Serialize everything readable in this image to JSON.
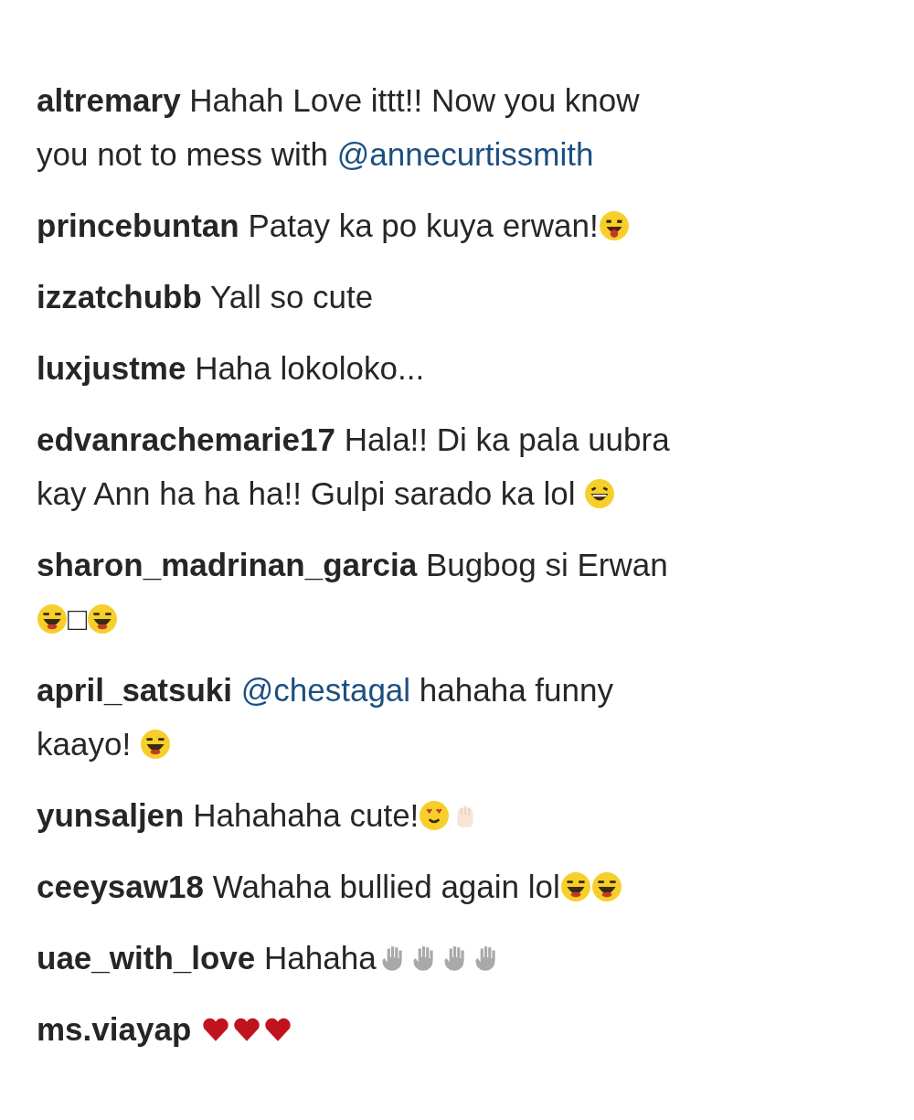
{
  "comments": [
    {
      "username": "altremary",
      "lines": [
        [
          {
            "kind": "text",
            "text": "Hahah Love ittt!! Now you know"
          }
        ],
        [
          {
            "kind": "text",
            "text": "you not to mess with "
          },
          {
            "kind": "mention",
            "text": "@annecurtissmith"
          }
        ]
      ]
    },
    {
      "username": "princebuntan",
      "lines": [
        [
          {
            "kind": "text",
            "text": "Patay ka po kuya erwan!"
          },
          {
            "kind": "tongue"
          }
        ]
      ]
    },
    {
      "username": "izzatchubb",
      "lines": [
        [
          {
            "kind": "text",
            "text": "Yall so cute"
          }
        ]
      ]
    },
    {
      "username": "luxjustme",
      "lines": [
        [
          {
            "kind": "text",
            "text": "Haha lokoloko..."
          }
        ]
      ]
    },
    {
      "username": "edvanrachemarie17",
      "lines": [
        [
          {
            "kind": "text",
            "text": "Hala!! Di ka pala uubra"
          }
        ],
        [
          {
            "kind": "text",
            "text": "kay Ann ha ha ha!! Gulpi sarado ka lol "
          },
          {
            "kind": "grin"
          }
        ]
      ]
    },
    {
      "username": "sharon_madrinan_garcia",
      "lines": [
        [
          {
            "kind": "text",
            "text": "Bugbog si Erwan"
          }
        ],
        [
          {
            "kind": "laugh"
          },
          {
            "kind": "text",
            "text": "□"
          },
          {
            "kind": "laugh"
          }
        ]
      ]
    },
    {
      "username": "april_satsuki",
      "lines": [
        [
          {
            "kind": "mention",
            "text": "@chestagal"
          },
          {
            "kind": "text",
            "text": " hahaha funny"
          }
        ],
        [
          {
            "kind": "text",
            "text": "kaayo! "
          },
          {
            "kind": "laugh"
          }
        ]
      ]
    },
    {
      "username": "yunsaljen",
      "lines": [
        [
          {
            "kind": "text",
            "text": "Hahahaha cute!"
          },
          {
            "kind": "heart-eyes"
          },
          {
            "kind": "clap"
          }
        ]
      ]
    },
    {
      "username": "ceeysaw18",
      "lines": [
        [
          {
            "kind": "text",
            "text": "Wahaha bullied again lol"
          },
          {
            "kind": "laugh"
          },
          {
            "kind": "laugh"
          }
        ]
      ]
    },
    {
      "username": "uae_with_love",
      "lines": [
        [
          {
            "kind": "text",
            "text": "Hahaha"
          },
          {
            "kind": "wave"
          },
          {
            "kind": "wave"
          },
          {
            "kind": "wave"
          },
          {
            "kind": "wave"
          }
        ]
      ]
    },
    {
      "username": "ms.viayap",
      "lines": [
        [
          {
            "kind": "heart"
          },
          {
            "kind": "heart"
          },
          {
            "kind": "heart"
          }
        ]
      ]
    }
  ]
}
